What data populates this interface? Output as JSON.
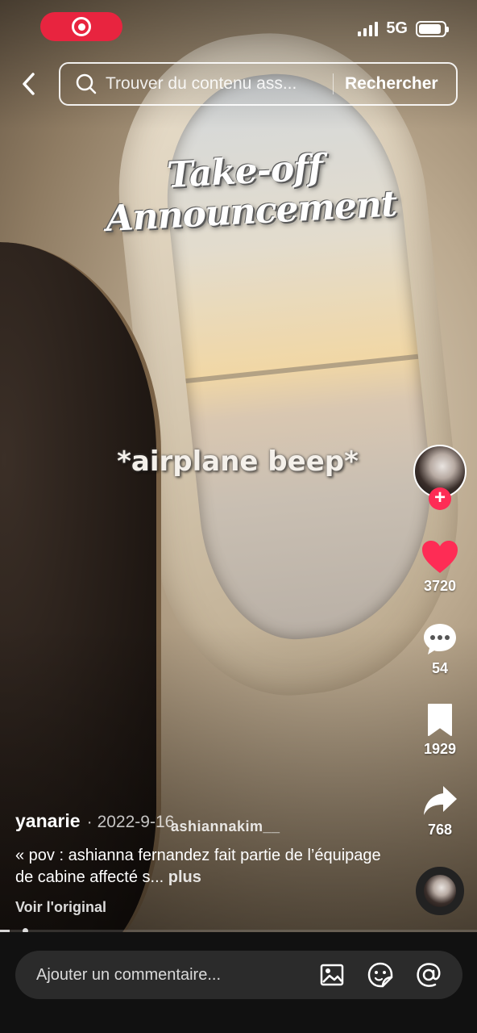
{
  "status_bar": {
    "network": "5G",
    "signal_bars": 4,
    "battery_level": 0.9,
    "recording": true
  },
  "search": {
    "placeholder": "Trouver du contenu ass...",
    "action_label": "Rechercher"
  },
  "video": {
    "overlay_title_line1": "Take-off",
    "overlay_title_line2": "Announcement",
    "overlay_text": "*airplane beep*",
    "watermark": "ashiannakim__"
  },
  "rail": {
    "likes": "3720",
    "comments": "54",
    "saves": "1929",
    "shares": "768",
    "follow_symbol": "+"
  },
  "post": {
    "author": "yanarie",
    "date_prefix": "·",
    "date": "2022-9-16",
    "caption": "« pov : ashianna fernandez fait partie de l’équipage de cabine affecté s...",
    "more_label": "plus",
    "view_original": "Voir l'original",
    "progress": 0.02
  },
  "comment_bar": {
    "placeholder": "Ajouter un commentaire..."
  },
  "colors": {
    "accent": "#fe2c55",
    "record": "#e8243f"
  },
  "icons": [
    "back-icon",
    "search-icon",
    "heart-icon",
    "comment-icon",
    "bookmark-icon",
    "share-icon",
    "image-icon",
    "emoji-icon",
    "mention-icon"
  ]
}
